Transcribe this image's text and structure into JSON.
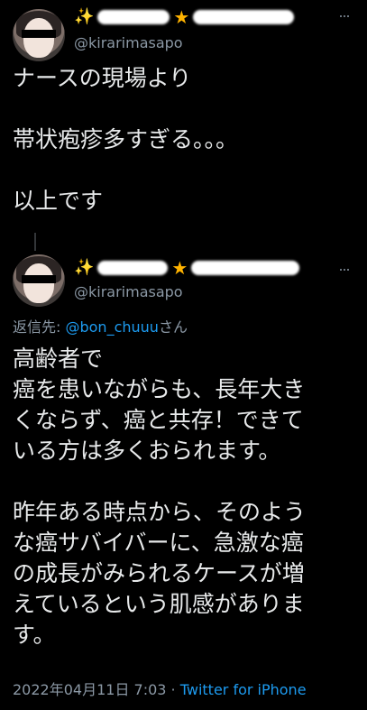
{
  "tweet1": {
    "handle": "@kirarimasapo",
    "body_lines": [
      "ナースの現場より",
      "",
      "帯状疱疹多すぎる。。。",
      "",
      "以上です"
    ]
  },
  "tweet2": {
    "handle": "@kirarimasapo",
    "reply_prefix": "返信先: ",
    "reply_to": "@bon_chuuu",
    "reply_suffix": "さん",
    "body_lines": [
      "高齢者で",
      "癌を患いながらも、長年大き",
      "くならず、癌と共存！できて",
      "いる方は多くおられます。",
      "",
      "昨年ある時点から、そのよう",
      "な癌サバイバーに、急激な癌",
      "の成長がみられるケースが増",
      "えているという肌感がありま",
      "す。"
    ],
    "timestamp": "2022年04月11日 7:03",
    "separator": " · ",
    "source": "Twitter for iPhone"
  },
  "icons": {
    "sparkle": "sparkles-icon",
    "star": "star-icon",
    "more": "more-icon"
  },
  "colors": {
    "background": "#000000",
    "text": "#e7e9ea",
    "secondary": "#8b98a5",
    "link": "#1d9bf0",
    "star": "#ffb300"
  }
}
